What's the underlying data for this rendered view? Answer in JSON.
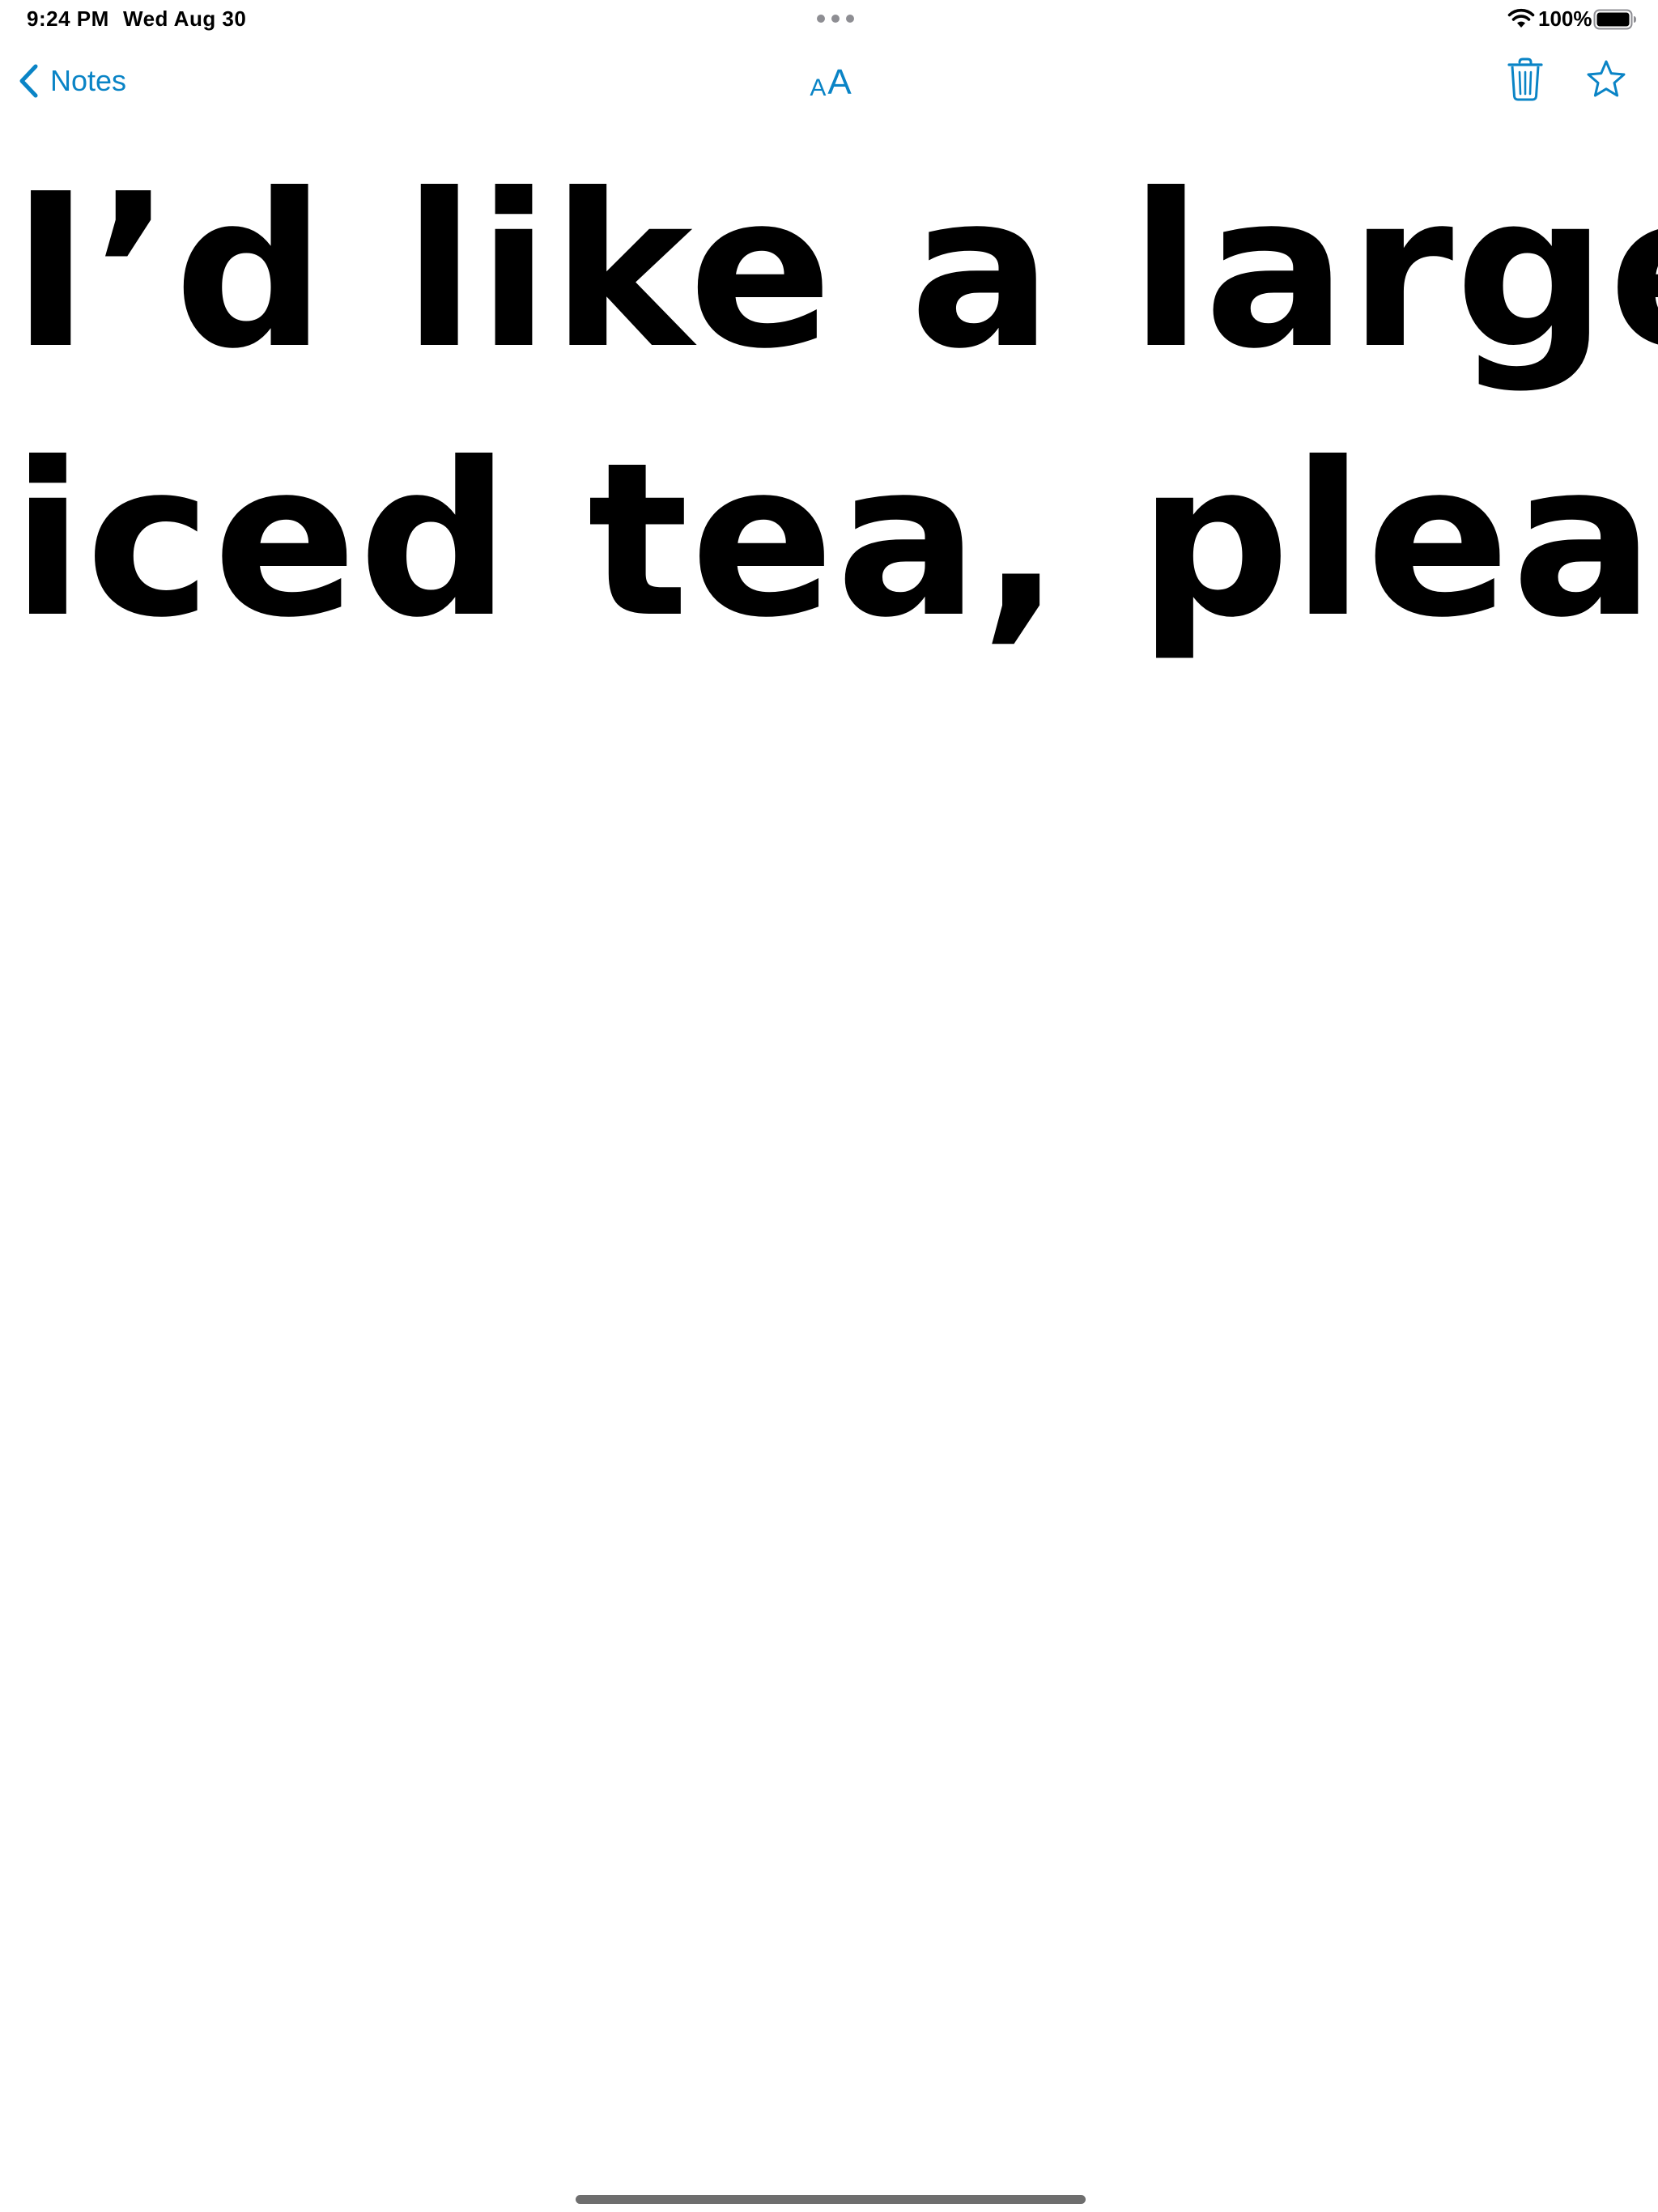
{
  "status_bar": {
    "time": "9:24 PM",
    "date": "Wed Aug 30",
    "battery_percent": "100%"
  },
  "nav": {
    "back_label": "Notes",
    "text_size_small": "A",
    "text_size_large": "A",
    "accent_color": "#0a84c6"
  },
  "icons": {
    "back": "chevron-left-icon",
    "text_size": "text-size-icon",
    "trash": "trash-icon",
    "favorite": "star-icon",
    "wifi": "wifi-icon",
    "battery": "battery-icon",
    "multitask": "more-dots-icon"
  },
  "note": {
    "lines": [
      "I’d like a large",
      "iced tea, please"
    ]
  }
}
